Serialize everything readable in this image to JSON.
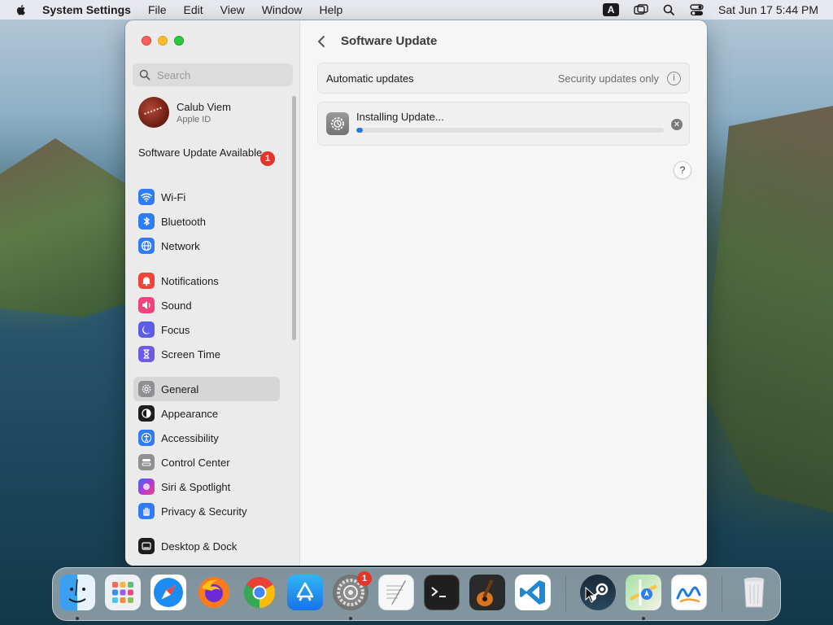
{
  "menubar": {
    "app_name": "System Settings",
    "menus": [
      "File",
      "Edit",
      "View",
      "Window",
      "Help"
    ],
    "input_source": "A",
    "datetime": "Sat Jun 17  5:44 PM"
  },
  "sidebar": {
    "search_placeholder": "Search",
    "account": {
      "name": "Calub Viem",
      "subtitle": "Apple ID"
    },
    "update_notice": {
      "label": "Software Update Available",
      "badge": "1"
    },
    "groups": [
      [
        {
          "label": "Wi-Fi",
          "icon": "wifi-icon",
          "color": "#2f7cf6"
        },
        {
          "label": "Bluetooth",
          "icon": "bluetooth-icon",
          "color": "#2f7cf6"
        },
        {
          "label": "Network",
          "icon": "globe-icon",
          "color": "#2f7cf6"
        }
      ],
      [
        {
          "label": "Notifications",
          "icon": "bell-icon",
          "color": "#f0443a"
        },
        {
          "label": "Sound",
          "icon": "speaker-icon",
          "color": "#f0447a"
        },
        {
          "label": "Focus",
          "icon": "moon-icon",
          "color": "#5d5ce6"
        },
        {
          "label": "Screen Time",
          "icon": "hourglass-icon",
          "color": "#6b5be6"
        }
      ],
      [
        {
          "label": "General",
          "icon": "gear-icon",
          "color": "#8e8e93",
          "selected": true
        },
        {
          "label": "Appearance",
          "icon": "appearance-icon",
          "color": "#1d1d1f"
        },
        {
          "label": "Accessibility",
          "icon": "accessibility-icon",
          "color": "#2f7cf6"
        },
        {
          "label": "Control Center",
          "icon": "control-center-icon",
          "color": "#8e8e93"
        },
        {
          "label": "Siri & Spotlight",
          "icon": "siri-icon",
          "color": "#b03ad6"
        },
        {
          "label": "Privacy & Security",
          "icon": "hand-icon",
          "color": "#2f7cf6"
        }
      ],
      [
        {
          "label": "Desktop & Dock",
          "icon": "dock-icon",
          "color": "#1d1d1f"
        }
      ]
    ]
  },
  "main": {
    "title": "Software Update",
    "automatic_updates": {
      "label": "Automatic updates",
      "value": "Security updates only"
    },
    "install": {
      "label": "Installing Update...",
      "progress_percent": 2
    },
    "help_label": "?"
  },
  "dock": {
    "apps": [
      {
        "name": "Finder",
        "icon": "finder-icon",
        "running": true
      },
      {
        "name": "Launchpad",
        "icon": "launchpad-icon",
        "running": false
      },
      {
        "name": "Safari",
        "icon": "safari-icon",
        "running": false
      },
      {
        "name": "Firefox",
        "icon": "firefox-icon",
        "running": false
      },
      {
        "name": "Chrome",
        "icon": "chrome-icon",
        "running": false
      },
      {
        "name": "App Store",
        "icon": "app-store-icon",
        "running": false
      },
      {
        "name": "System Settings",
        "icon": "system-settings-icon",
        "running": true,
        "badge": "1"
      },
      {
        "name": "TextEdit",
        "icon": "textedit-icon",
        "running": false
      },
      {
        "name": "Terminal",
        "icon": "terminal-icon",
        "running": false
      },
      {
        "name": "GarageBand",
        "icon": "garageband-icon",
        "running": false
      },
      {
        "name": "VS Code",
        "icon": "vscode-icon",
        "running": false
      },
      {
        "name": "Steam",
        "icon": "steam-icon",
        "running": false
      },
      {
        "name": "Maps",
        "icon": "maps-icon",
        "running": true
      },
      {
        "name": "Freeform",
        "icon": "freeform-icon",
        "running": false
      },
      {
        "name": "Trash",
        "icon": "trash-icon",
        "running": false
      }
    ]
  }
}
